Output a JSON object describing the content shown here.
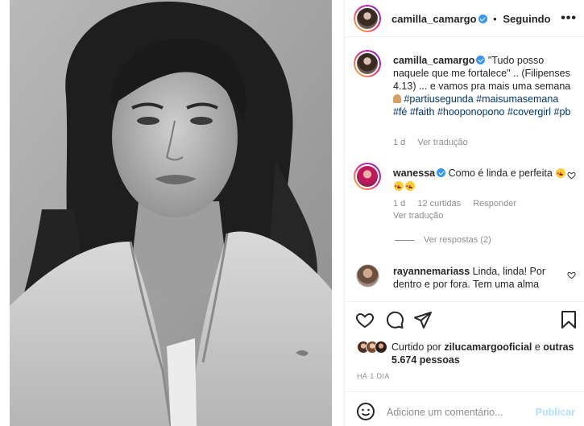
{
  "header": {
    "username": "camilla_camargo",
    "separator": "•",
    "follow_status": "Seguindo",
    "more_icon": "more-horizontal-icon"
  },
  "caption": {
    "username": "camilla_camargo",
    "text_part1": " \"Tudo posso naquele que me fortalece\" .. (Filipenses 4.13) ... e vamos pra mais uma semana ",
    "emoji": "🙏🏽",
    "hashtags": [
      "#partiusegunda",
      "#maisumasemana",
      "#fé",
      "#faith",
      "#hooponopono",
      "#covergirl",
      "#pb"
    ],
    "age": "1 d",
    "see_translation": "Ver tradução"
  },
  "comments": [
    {
      "username": "wanessa",
      "verified": true,
      "text": " Como é linda e perfeita",
      "emojis": "😍😍😍",
      "age": "1 d",
      "likes": "12 curtidas",
      "reply": "Responder",
      "see_translation": "Ver tradução",
      "view_replies": "Ver respostas (2)"
    },
    {
      "username": "rayannemariass",
      "verified": false,
      "text": " Linda, linda! Por dentro e por fora. Tem uma alma"
    }
  ],
  "actions": {
    "like_icon": "heart-icon",
    "comment_icon": "comment-icon",
    "share_icon": "share-icon",
    "save_icon": "bookmark-icon"
  },
  "likes": {
    "prefix": "Curtido por ",
    "user": "zilucamargooficial",
    "middle": " e ",
    "others": "outras 5.674 pessoas"
  },
  "time": "HÁ 1 DIA",
  "add_comment": {
    "placeholder": "Adicione um comentário...",
    "post_label": "Publicar",
    "emoji_icon": "smiley-icon"
  },
  "colors": {
    "link": "#00376b",
    "verified": "#3897f0",
    "muted": "#8e8e8e",
    "post_disabled": "#b2dffc"
  }
}
